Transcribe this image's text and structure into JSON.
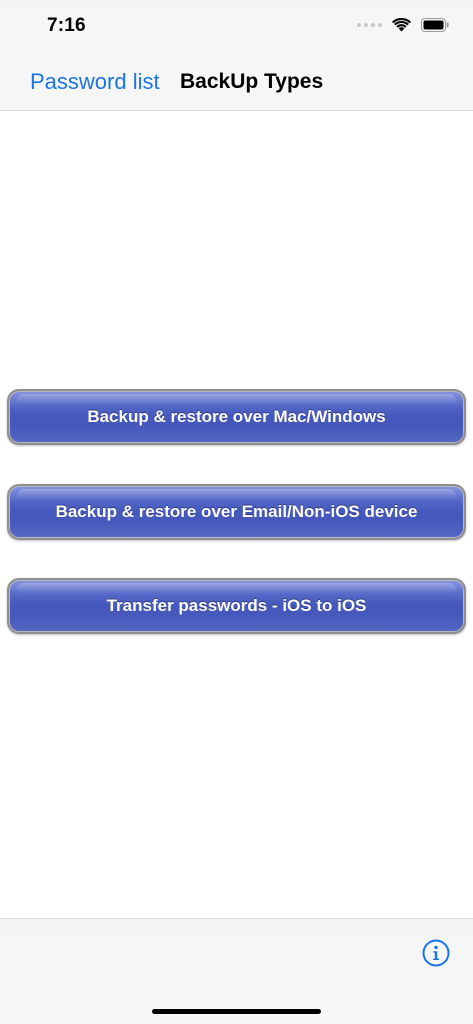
{
  "status_bar": {
    "time": "7:16"
  },
  "nav": {
    "back_label": "Password list",
    "title": "BackUp Types"
  },
  "buttons": [
    {
      "label": "Backup & restore over Mac/Windows"
    },
    {
      "label": "Backup & restore over Email/Non-iOS device"
    },
    {
      "label": "Transfer passwords - iOS to iOS"
    }
  ],
  "toolbar": {
    "info_icon": "info-icon"
  },
  "colors": {
    "accent": "#1a74e8",
    "button_blue": "#4457bb"
  }
}
